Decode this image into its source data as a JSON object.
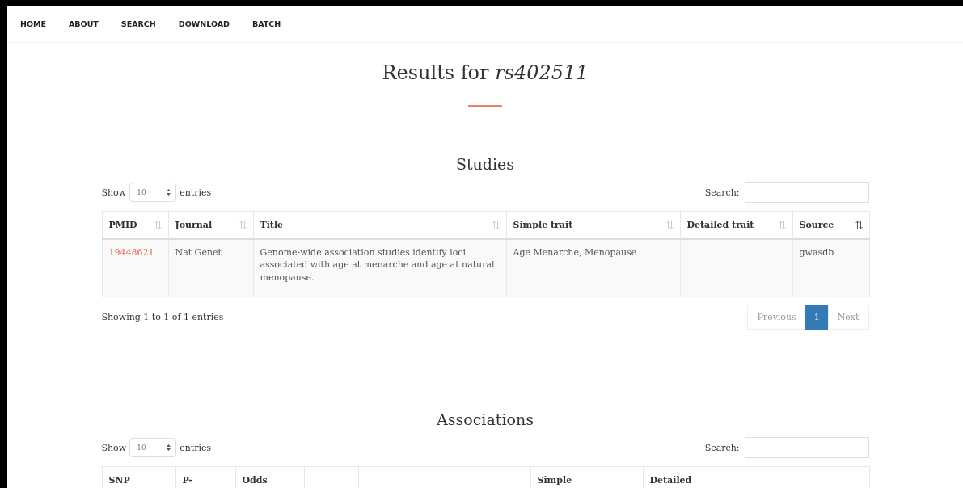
{
  "nav": [
    "HOME",
    "ABOUT",
    "SEARCH",
    "DOWNLOAD",
    "BATCH"
  ],
  "title": "Results for *rs402511*",
  "sections": [
    {
      "heading": "Studies",
      "show_label": "Show",
      "page_size": "10",
      "entries_label": "entries",
      "search_label": "Search:",
      "columns": [
        {
          "label": "PMID",
          "sorted": false
        },
        {
          "label": "Journal",
          "sorted": false
        },
        {
          "label": "Title",
          "sorted": false
        },
        {
          "label": "Simple trait",
          "sorted": false
        },
        {
          "label": "Detailed trait",
          "sorted": false
        },
        {
          "label": "Source",
          "sorted": true
        }
      ],
      "rows": [
        [
          "19448621",
          "Nat Genet",
          "Genome-wide association studies identify loci associated with age at menarche and age at natural menopause.",
          "Age Menarche, Menopause",
          null,
          "gwasdb"
        ]
      ],
      "info": "Showing 1 to 1 of 1 entries",
      "pagination": [
        {
          "label": "Previous",
          "selected": false
        },
        {
          "label": "1",
          "selected": true
        },
        {
          "label": "Next",
          "selected": false
        }
      ]
    },
    {
      "heading": "Associations",
      "show_label": "Show",
      "page_size": "10",
      "entries_label": "entries",
      "search_label": "Search:",
      "columns": [
        {
          "label": "SNP"
        },
        {
          "label": "P-"
        },
        {
          "label": "Odds"
        },
        {},
        {},
        {},
        {
          "label": "Simple"
        },
        {
          "label": "Detailed"
        },
        {},
        {}
      ]
    }
  ]
}
